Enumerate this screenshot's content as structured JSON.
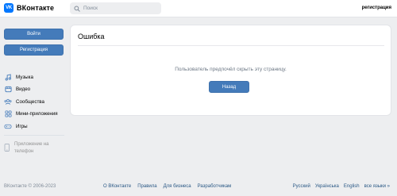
{
  "header": {
    "logo_text": "ВКонтакте",
    "logo_mark": "VK",
    "search_placeholder": "Поиск",
    "register_link": "регистрация"
  },
  "sidebar": {
    "login_button": "Войти",
    "register_button": "Регистрация",
    "items": [
      {
        "label": "Музыка",
        "icon": "music-icon"
      },
      {
        "label": "Видео",
        "icon": "video-icon"
      },
      {
        "label": "Сообщества",
        "icon": "communities-icon"
      },
      {
        "label": "Мини-приложения",
        "icon": "mini-apps-icon"
      },
      {
        "label": "Игры",
        "icon": "games-icon"
      }
    ],
    "app_phone_label": "Приложение на телефон"
  },
  "main": {
    "title": "Ошибка",
    "message": "Пользователь предпочёл скрыть эту страницу.",
    "back_button": "Назад"
  },
  "footer": {
    "copyright": "ВКонтакте © 2006-2023",
    "links": [
      "О ВКонтакте",
      "Правила",
      "Для бизнеса",
      "Разработчикам"
    ],
    "languages": [
      "Русский",
      "Українська",
      "English",
      "все языки »"
    ]
  },
  "colors": {
    "accent": "#447bba",
    "brand": "#0077ff",
    "background": "#edeef0",
    "link": "#2a5885"
  }
}
